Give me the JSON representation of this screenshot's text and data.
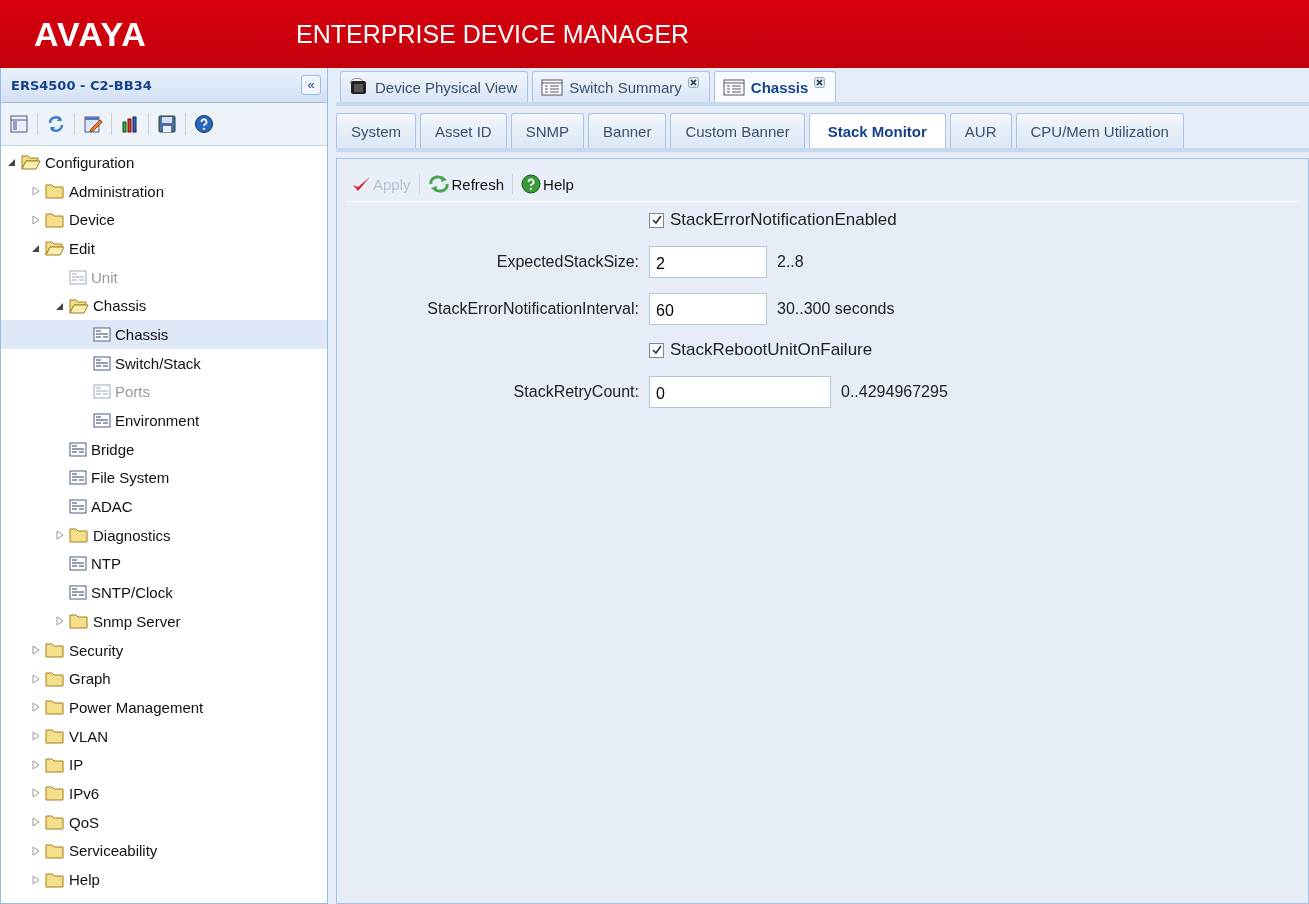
{
  "header": {
    "logo": "AVAYA",
    "title": "ENTERPRISE DEVICE MANAGER"
  },
  "sidebar": {
    "title": "ERS4500 - C2-BB34",
    "collapse": "«",
    "tree": [
      {
        "label": "Configuration",
        "kind": "folder",
        "expanded": true,
        "selected": false,
        "disabled": false,
        "children": [
          {
            "label": "Administration",
            "kind": "folder",
            "expanded": false,
            "selected": false,
            "disabled": false
          },
          {
            "label": "Device",
            "kind": "folder",
            "expanded": false,
            "selected": false,
            "disabled": false
          },
          {
            "label": "Edit",
            "kind": "folder",
            "expanded": true,
            "selected": false,
            "disabled": false,
            "children": [
              {
                "label": "Unit",
                "kind": "page",
                "selected": false,
                "disabled": true
              },
              {
                "label": "Chassis",
                "kind": "folder",
                "expanded": true,
                "selected": false,
                "disabled": false,
                "children": [
                  {
                    "label": "Chassis",
                    "kind": "page",
                    "selected": true,
                    "disabled": false
                  },
                  {
                    "label": "Switch/Stack",
                    "kind": "page",
                    "selected": false,
                    "disabled": false
                  },
                  {
                    "label": "Ports",
                    "kind": "page",
                    "selected": false,
                    "disabled": true
                  },
                  {
                    "label": "Environment",
                    "kind": "page",
                    "selected": false,
                    "disabled": false
                  }
                ]
              },
              {
                "label": "Bridge",
                "kind": "page",
                "selected": false,
                "disabled": false
              },
              {
                "label": "File System",
                "kind": "page",
                "selected": false,
                "disabled": false
              },
              {
                "label": "ADAC",
                "kind": "page",
                "selected": false,
                "disabled": false
              },
              {
                "label": "Diagnostics",
                "kind": "folder",
                "expanded": false,
                "selected": false,
                "disabled": false
              },
              {
                "label": "NTP",
                "kind": "page",
                "selected": false,
                "disabled": false
              },
              {
                "label": "SNTP/Clock",
                "kind": "page",
                "selected": false,
                "disabled": false
              },
              {
                "label": "Snmp Server",
                "kind": "folder",
                "expanded": false,
                "selected": false,
                "disabled": false
              }
            ]
          },
          {
            "label": "Security",
            "kind": "folder",
            "expanded": false,
            "selected": false,
            "disabled": false
          },
          {
            "label": "Graph",
            "kind": "folder",
            "expanded": false,
            "selected": false,
            "disabled": false
          },
          {
            "label": "Power Management",
            "kind": "folder",
            "expanded": false,
            "selected": false,
            "disabled": false
          },
          {
            "label": "VLAN",
            "kind": "folder",
            "expanded": false,
            "selected": false,
            "disabled": false
          },
          {
            "label": "IP",
            "kind": "folder",
            "expanded": false,
            "selected": false,
            "disabled": false
          },
          {
            "label": "IPv6",
            "kind": "folder",
            "expanded": false,
            "selected": false,
            "disabled": false
          },
          {
            "label": "QoS",
            "kind": "folder",
            "expanded": false,
            "selected": false,
            "disabled": false
          },
          {
            "label": "Serviceability",
            "kind": "folder",
            "expanded": false,
            "selected": false,
            "disabled": false
          },
          {
            "label": "Help",
            "kind": "folder",
            "expanded": false,
            "selected": false,
            "disabled": false
          }
        ]
      }
    ]
  },
  "doc_tabs": [
    {
      "label": "Device Physical View",
      "kind": "device",
      "selected": false,
      "closable": false
    },
    {
      "label": "Switch Summary",
      "kind": "page",
      "selected": false,
      "closable": true
    },
    {
      "label": "Chassis",
      "kind": "page",
      "selected": true,
      "closable": true
    }
  ],
  "sub_tabs": [
    {
      "label": "System",
      "selected": false
    },
    {
      "label": "Asset ID",
      "selected": false
    },
    {
      "label": "SNMP",
      "selected": false
    },
    {
      "label": "Banner",
      "selected": false
    },
    {
      "label": "Custom Banner",
      "selected": false
    },
    {
      "label": "Stack Monitor",
      "selected": true
    },
    {
      "label": "AUR",
      "selected": false
    },
    {
      "label": "CPU/Mem Utilization",
      "selected": false
    }
  ],
  "toolbar": [
    {
      "label": "Apply",
      "kind": "apply",
      "disabled": true
    },
    {
      "label": "Refresh",
      "kind": "refresh",
      "disabled": false
    },
    {
      "label": "Help",
      "kind": "help",
      "disabled": false
    }
  ],
  "form": [
    {
      "kind": "checkbox",
      "label": "StackErrorNotificationEnabled",
      "checked": true
    },
    {
      "kind": "text",
      "label": "ExpectedStackSize:",
      "value": "2",
      "hint": "2..8"
    },
    {
      "kind": "text",
      "label": "StackErrorNotificationInterval:",
      "value": "60",
      "hint": "30..300 seconds"
    },
    {
      "kind": "checkbox",
      "label": "StackRebootUnitOnFailure",
      "checked": true
    },
    {
      "kind": "widetext",
      "label": "StackRetryCount:",
      "value": "0",
      "hint": "0..4294967295"
    }
  ]
}
